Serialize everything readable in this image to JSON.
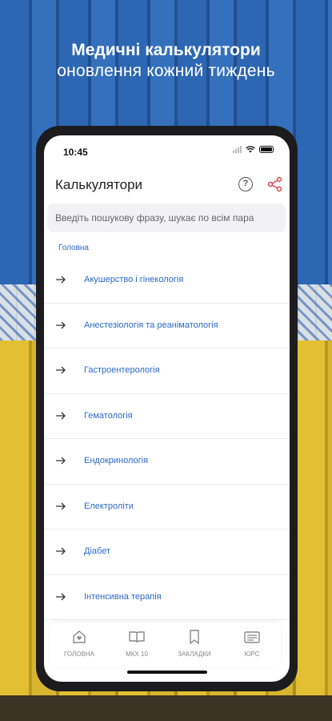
{
  "headline": {
    "line1": "Медичні калькулятори",
    "line2": "оновлення кожний тиждень"
  },
  "status_bar": {
    "time": "10:45"
  },
  "app_bar": {
    "title": "Калькулятори"
  },
  "search": {
    "placeholder": "Введіть пошукову фразу, шукає по всім пара"
  },
  "breadcrumb": "Головна",
  "categories": [
    "Акушерство і гінекологія",
    "Анестезіологія та реаніматологія",
    "Гастроентерологія",
    "Гематологія",
    "Ендокринологія",
    "Електроліти",
    "Діабет",
    "Інтенсивна терапія"
  ],
  "tabs": [
    {
      "label": "ГОЛОВНА",
      "icon": "home-heart-icon"
    },
    {
      "label": "МКХ 10",
      "icon": "book-icon"
    },
    {
      "label": "ЗАКЛАДКИ",
      "icon": "bookmark-icon"
    },
    {
      "label": "ЮРС",
      "icon": "document-list-icon"
    }
  ],
  "colors": {
    "accent": "#2c68c9",
    "share": "#e0404a"
  }
}
